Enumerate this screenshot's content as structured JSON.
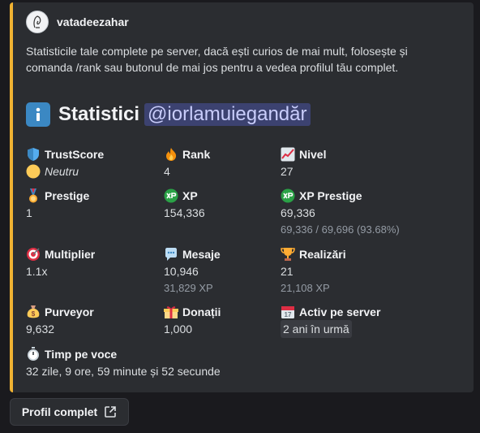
{
  "embed": {
    "accent": "#f0b232",
    "author": "vatadeezahar",
    "description": "Statisticile tale complete pe server, dacă ești curios de mai mult, folosește și comanda /rank sau butonul de mai jos pentru a vedea profilul tău complet.",
    "title": "Statistici",
    "mention": "@iorlamuiegandăr"
  },
  "fields": {
    "trustscore": {
      "name": "TrustScore",
      "value": "Neutru",
      "icon": "shield-icon"
    },
    "rank": {
      "name": "Rank",
      "value": "4",
      "icon": "fire-icon"
    },
    "nivel": {
      "name": "Nivel",
      "value": "27",
      "icon": "chart-increasing-icon"
    },
    "prestige": {
      "name": "Prestige",
      "value": "1",
      "icon": "medal-icon"
    },
    "xp": {
      "name": "XP",
      "value": "154,336",
      "icon": "xp-icon"
    },
    "xp_prestige": {
      "name": "XP Prestige",
      "value": "69,336",
      "sub": "69,336 / 69,696 (93.68%)",
      "icon": "xp-icon"
    },
    "multiplier": {
      "name": "Multiplier",
      "value": "1.1x",
      "icon": "target-icon"
    },
    "mesaje": {
      "name": "Mesaje",
      "value": "10,946",
      "sub": "31,829 XP",
      "icon": "speech-bubble-icon"
    },
    "realizari": {
      "name": "Realizări",
      "value": "21",
      "sub": "21,108 XP",
      "icon": "trophy-icon"
    },
    "purveyor": {
      "name": "Purveyor",
      "value": "9,632",
      "icon": "money-bag-icon"
    },
    "donatii": {
      "name": "Donații",
      "value": "1,000",
      "icon": "gift-icon"
    },
    "activ": {
      "name": "Activ pe server",
      "value": "2 ani în urmă",
      "icon": "calendar-icon"
    },
    "timp_voce": {
      "name": "Timp pe voce",
      "value": "32 zile, 9 ore, 59 minute și 52 secunde",
      "icon": "stopwatch-icon"
    }
  },
  "button": {
    "label": "Profil complet",
    "icon": "external-link-icon"
  }
}
